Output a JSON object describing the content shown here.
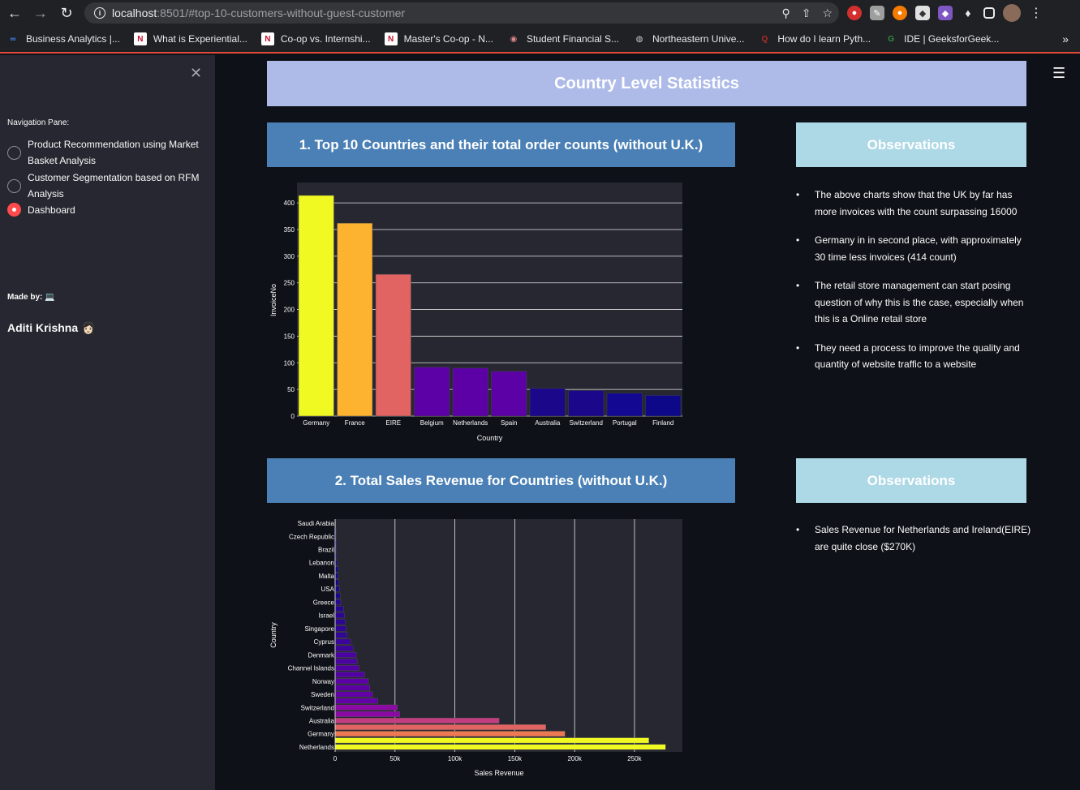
{
  "browser": {
    "url_host": "localhost",
    "url_path": ":8501/#top-10-customers-without-guest-customer",
    "bookmarks": [
      {
        "label": "Business Analytics |...",
        "icon": "infinity-icon",
        "color": "#4285f4"
      },
      {
        "label": "What is Experiential...",
        "icon": "northeastern-n-icon",
        "color": "#c8102e"
      },
      {
        "label": "Co-op vs. Internshi...",
        "icon": "northeastern-n-icon",
        "color": "#c8102e"
      },
      {
        "label": "Master's Co-op - N...",
        "icon": "northeastern-n-icon",
        "color": "#c8102e"
      },
      {
        "label": "Student Financial S...",
        "icon": "seal-icon",
        "color": "#d88"
      },
      {
        "label": "Northeastern Unive...",
        "icon": "globe-icon",
        "color": "#ccc"
      },
      {
        "label": "How do I learn Pyth...",
        "icon": "quora-icon",
        "color": "#b92b27"
      },
      {
        "label": "IDE | GeeksforGeek...",
        "icon": "gfg-icon",
        "color": "#2f8d46"
      }
    ],
    "more_label": "»"
  },
  "sidebar": {
    "nav_label": "Navigation Pane:",
    "options": [
      {
        "line1": "Product Recommendation using Market",
        "line2": "Basket Analysis",
        "selected": false
      },
      {
        "line1": "Customer Segmentation based on RFM",
        "line2": "Analysis",
        "selected": false
      },
      {
        "line1": "Dashboard",
        "line2": "",
        "selected": true
      }
    ],
    "made_by": "Made by: 💻",
    "author": "Aditi Krishna 👩🏻"
  },
  "main": {
    "title": "Country Level Statistics",
    "section1_title": "1. Top 10 Countries and their total order counts (without U.K.)",
    "section2_title": "2. Total Sales Revenue for Countries (without U.K.)",
    "obs_title": "Observations",
    "obs1": [
      "The above charts show that the UK by far has more invoices with the count surpassing 16000",
      "Germany in in second place, with approximately 30 time less invoices (414 count)",
      "The retail store management can start posing question of why this is the case, especially when this is a Online retail store",
      "They need a process to improve the quality and quantity of website traffic to a website"
    ],
    "obs2": [
      "Sales Revenue for Netherlands and Ireland(EIRE) are quite close ($270K)"
    ]
  },
  "chart_data": [
    {
      "type": "bar",
      "xlabel": "Country",
      "ylabel": "InvoiceNo",
      "ylim": [
        0,
        420
      ],
      "yticks": [
        0,
        50,
        100,
        150,
        200,
        250,
        300,
        350,
        400
      ],
      "categories": [
        "Germany",
        "France",
        "EIRE",
        "Belgium",
        "Netherlands",
        "Spain",
        "Australia",
        "Switzerland",
        "Portugal",
        "Finland"
      ],
      "values": [
        414,
        362,
        266,
        92,
        90,
        84,
        52,
        48,
        43,
        39
      ],
      "colors": [
        "#f0f921",
        "#fdb32f",
        "#e16462",
        "#5c01a6",
        "#5c01a6",
        "#5c01a6",
        "#1a078a",
        "#1a078a",
        "#130891",
        "#0d0887"
      ],
      "grid": true
    },
    {
      "type": "bar",
      "orientation": "horizontal",
      "xlabel": "Sales Revenue",
      "ylabel": "Country",
      "xlim": [
        0,
        290000
      ],
      "xticks": [
        0,
        50000,
        100000,
        150000,
        200000,
        250000
      ],
      "xtick_labels": [
        "0",
        "50k",
        "100k",
        "150k",
        "200k",
        "250k"
      ],
      "categories": [
        "Saudi Arabia",
        "",
        "Czech Republic",
        "",
        "Brazil",
        "",
        "Lebanon",
        "",
        "Malta",
        "",
        "USA",
        "",
        "Greece",
        "",
        "Israel",
        "",
        "Singapore",
        "",
        "Cyprus",
        "",
        "Denmark",
        "",
        "Channel Islands",
        "",
        "Norway",
        "",
        "Sweden",
        "",
        "Switzerland",
        "",
        "Australia",
        "",
        "Germany",
        "",
        "Netherlands"
      ],
      "values": [
        130,
        700,
        800,
        1100,
        1100,
        1300,
        1700,
        2500,
        2500,
        3000,
        3500,
        4300,
        4700,
        7000,
        7900,
        8500,
        9100,
        10000,
        12900,
        15000,
        17600,
        18400,
        20000,
        24600,
        27800,
        29000,
        31200,
        35600,
        52000,
        54000,
        137000,
        176000,
        192000,
        262000,
        276000
      ],
      "colors": [
        "#0d0887",
        "#0d0887",
        "#0d0887",
        "#0d0887",
        "#0d0887",
        "#0d0887",
        "#110789",
        "#110789",
        "#140689",
        "#140689",
        "#1c068c",
        "#1c068c",
        "#260591",
        "#260591",
        "#2c0594",
        "#2c0594",
        "#310597",
        "#310597",
        "#3d049b",
        "#3d049b",
        "#4903a0",
        "#4903a0",
        "#5202a3",
        "#5202a3",
        "#5c01a6",
        "#5c01a6",
        "#6300a7",
        "#6300a7",
        "#8b0aa5",
        "#8b0aa5",
        "#c33d80",
        "#e16462",
        "#ed7953",
        "#f0f921",
        "#f0f921"
      ],
      "grid": true
    }
  ]
}
